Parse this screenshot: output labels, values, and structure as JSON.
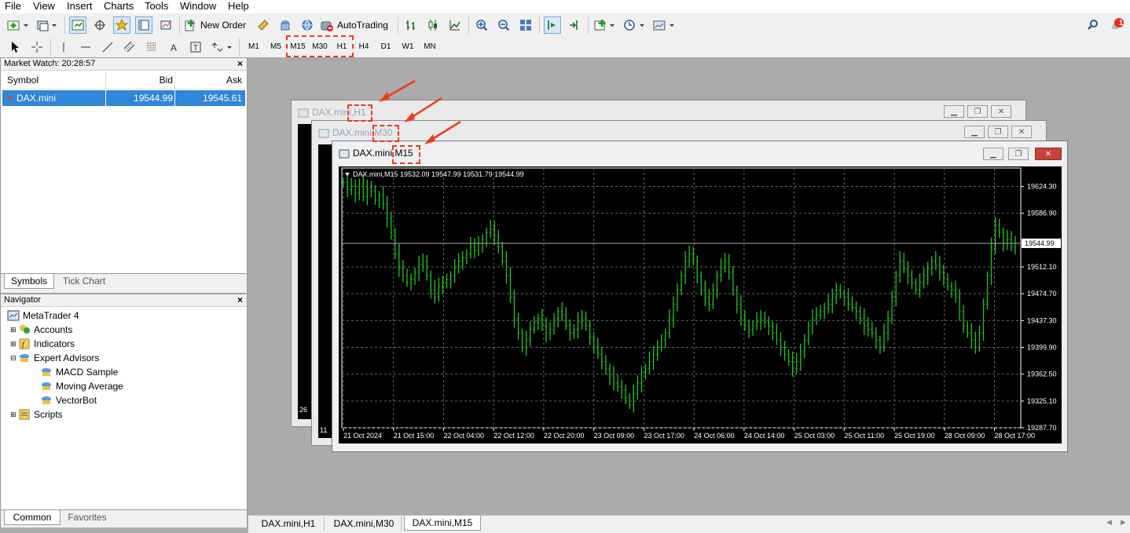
{
  "menu": [
    "File",
    "View",
    "Insert",
    "Charts",
    "Tools",
    "Window",
    "Help"
  ],
  "toolbar": {
    "new_order_label": "New Order",
    "autotrading_label": "AutoTrading",
    "notification_count": "1"
  },
  "periods": [
    "M1",
    "M5",
    "M15",
    "M30",
    "H1",
    "H4",
    "D1",
    "W1",
    "MN"
  ],
  "market_watch": {
    "title": "Market Watch: 20:28:57",
    "columns": [
      "Symbol",
      "Bid",
      "Ask"
    ],
    "rows": [
      {
        "symbol": "DAX.mini",
        "bid": "19544.99",
        "ask": "19545.61"
      }
    ],
    "tabs": [
      "Symbols",
      "Tick Chart"
    ]
  },
  "navigator": {
    "title": "Navigator",
    "root": "MetaTrader 4",
    "items": [
      "Accounts",
      "Indicators",
      "Expert Advisors",
      "Scripts"
    ],
    "experts": [
      "MACD Sample",
      "Moving Average",
      "VectorBot"
    ],
    "tabs": [
      "Common",
      "Favorites"
    ]
  },
  "windows": {
    "h1": {
      "title_symbol": "DAX.mini,",
      "title_period": "H1",
      "bottom_left": "26"
    },
    "m30": {
      "title_symbol": "DAX.mini,",
      "title_period": "M30",
      "bottom_left": "11"
    },
    "m15": {
      "title_symbol": "DAX.mini,",
      "title_period": "M15"
    }
  },
  "bottom_tabs": [
    "DAX.mini,H1",
    "DAX.mini,M30",
    "DAX.mini,M15"
  ],
  "chart_data": {
    "type": "bar",
    "title": "DAX.mini,M15  19532.09 19547.99 19531.79 19544.99",
    "symbol": "DAX.mini",
    "period": "M15",
    "ohlc_header": "19532.09 19547.99 19531.79 19544.99",
    "current_price": "19544.99",
    "current_price_value": 19544.99,
    "ylim": [
      19287.7,
      19650.0
    ],
    "y_ticks": [
      "19624.30",
      "19586.90",
      "19512.10",
      "19474.70",
      "19437.30",
      "19399.90",
      "19362.50",
      "19325.10",
      "19287.70"
    ],
    "y_tick_values": [
      19624.3,
      19586.9,
      19512.1,
      19474.7,
      19437.3,
      19399.9,
      19362.5,
      19325.1,
      19287.7
    ],
    "x_ticks": [
      "21 Oct 2024",
      "21 Oct 15:00",
      "22 Oct 04:00",
      "22 Oct 12:00",
      "22 Oct 20:00",
      "23 Oct 09:00",
      "23 Oct 17:00",
      "24 Oct 06:00",
      "24 Oct 14:00",
      "25 Oct 03:00",
      "25 Oct 11:00",
      "25 Oct 19:00",
      "28 Oct 09:00",
      "28 Oct 17:00"
    ],
    "series": [
      {
        "values": [
          19630,
          19620,
          19625,
          19615,
          19628,
          19610,
          19622,
          19618,
          19605,
          19612,
          19600,
          19580,
          19560,
          19530,
          19510,
          19500,
          19490,
          19495,
          19505,
          19515,
          19520,
          19500,
          19480,
          19470,
          19485,
          19490,
          19495,
          19500,
          19510,
          19520,
          19525,
          19530,
          19540,
          19535,
          19545,
          19550,
          19560,
          19565,
          19555,
          19540,
          19520,
          19500,
          19470,
          19440,
          19420,
          19400,
          19410,
          19425,
          19435,
          19440,
          19430,
          19420,
          19425,
          19440,
          19450,
          19445,
          19430,
          19420,
          19425,
          19435,
          19440,
          19430,
          19415,
          19400,
          19390,
          19380,
          19370,
          19360,
          19350,
          19345,
          19340,
          19330,
          19320,
          19335,
          19350,
          19365,
          19370,
          19380,
          19390,
          19400,
          19410,
          19420,
          19440,
          19460,
          19480,
          19500,
          19520,
          19530,
          19520,
          19500,
          19480,
          19470,
          19460,
          19480,
          19500,
          19510,
          19520,
          19505,
          19480,
          19460,
          19440,
          19430,
          19425,
          19430,
          19435,
          19440,
          19435,
          19430,
          19420,
          19410,
          19400,
          19390,
          19380,
          19370,
          19380,
          19395,
          19410,
          19430,
          19440,
          19445,
          19450,
          19455,
          19460,
          19470,
          19480,
          19475,
          19470,
          19460,
          19455,
          19450,
          19440,
          19430,
          19425,
          19420,
          19410,
          19400,
          19420,
          19440,
          19470,
          19500,
          19520,
          19510,
          19500,
          19490,
          19480,
          19490,
          19500,
          19510,
          19520,
          19515,
          19505,
          19495,
          19485,
          19480,
          19470,
          19450,
          19430,
          19420,
          19410,
          19400,
          19420,
          19460,
          19500,
          19540,
          19570,
          19560,
          19545,
          19550,
          19540,
          19545
        ]
      }
    ]
  }
}
